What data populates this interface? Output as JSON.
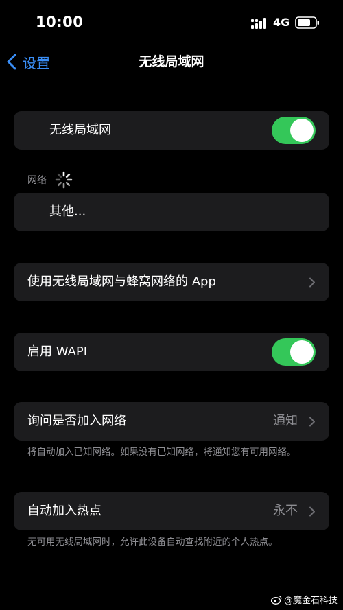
{
  "status_bar": {
    "time": "10:00",
    "network_type": "4G",
    "icons": [
      "signal-bars-icon",
      "battery-icon"
    ]
  },
  "nav": {
    "back_label": "设置",
    "title": "无线局域网",
    "back_icon": "chevron-left-icon"
  },
  "colors": {
    "accent": "#3a8ef6",
    "toggle_on": "#34c759",
    "cell_bg": "#1c1c1e",
    "secondary_text": "#8e8e93"
  },
  "wifi": {
    "label": "无线局域网",
    "enabled": true
  },
  "networks": {
    "header": "网络",
    "loading_icon": "spinner-icon",
    "other_label": "其他..."
  },
  "apps_row": {
    "label": "使用无线局域网与蜂窝网络的 App"
  },
  "wapi": {
    "label": "启用 WAPI",
    "enabled": true
  },
  "ask_to_join": {
    "label": "询问是否加入网络",
    "value": "通知",
    "footer": "将自动加入已知网络。如果没有已知网络，将通知您有可用网络。"
  },
  "auto_hotspot": {
    "label": "自动加入热点",
    "value": "永不",
    "footer": "无可用无线局域网时，允许此设备自动查找附近的个人热点。"
  },
  "watermark": {
    "text": "@魔金石科技",
    "icon": "weibo-icon"
  }
}
